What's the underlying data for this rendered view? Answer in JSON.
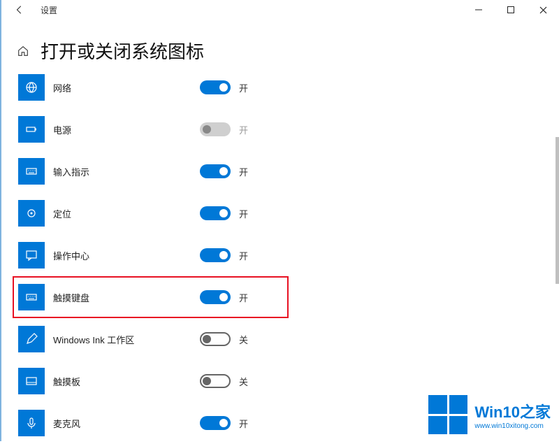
{
  "window": {
    "title": "设置"
  },
  "header": {
    "page_title": "打开或关闭系统图标"
  },
  "state_labels": {
    "on": "开",
    "off": "关"
  },
  "items": [
    {
      "label": "网络",
      "icon": "globe",
      "on": true,
      "disabled": false,
      "highlight": false
    },
    {
      "label": "电源",
      "icon": "battery",
      "on": false,
      "disabled": true,
      "highlight": false
    },
    {
      "label": "输入指示",
      "icon": "keyboard",
      "on": true,
      "disabled": false,
      "highlight": false
    },
    {
      "label": "定位",
      "icon": "locate",
      "on": true,
      "disabled": false,
      "highlight": false
    },
    {
      "label": "操作中心",
      "icon": "message",
      "on": true,
      "disabled": false,
      "highlight": false
    },
    {
      "label": "触摸键盘",
      "icon": "keyboard",
      "on": true,
      "disabled": false,
      "highlight": true
    },
    {
      "label": "Windows Ink 工作区",
      "icon": "pen",
      "on": false,
      "disabled": false,
      "highlight": false
    },
    {
      "label": "触摸板",
      "icon": "touchpad",
      "on": false,
      "disabled": false,
      "highlight": false
    },
    {
      "label": "麦克风",
      "icon": "mic",
      "on": true,
      "disabled": false,
      "highlight": false
    }
  ],
  "watermark": {
    "line1": "Win10之家",
    "line2": "www.win10xitong.com"
  }
}
